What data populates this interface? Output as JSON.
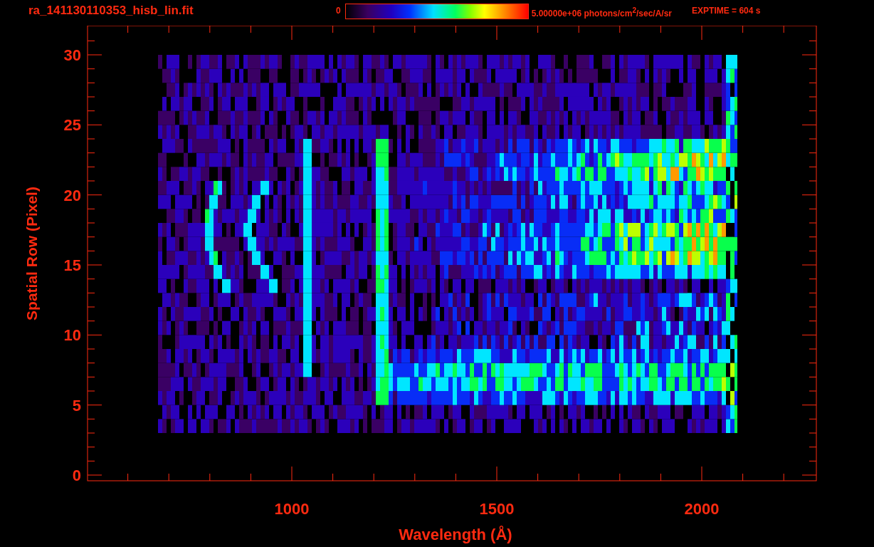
{
  "header": {
    "title": "ra_141130110353_hisb_lin.fit",
    "colorbar": {
      "min_label": "0",
      "max_label": "5.00000e+06 photons/cm$^{2}$/sec/A/sr"
    },
    "exposure": "EXPTIME = 604 s"
  },
  "plot": {
    "xlabel": "Wavelength (Å)",
    "ylabel": "Spatial Row (Pixel)",
    "xticks": [
      "1000",
      "1500",
      "2000"
    ],
    "yticks": [
      "30",
      "25",
      "20",
      "15",
      "10",
      "5",
      "0"
    ]
  }
}
